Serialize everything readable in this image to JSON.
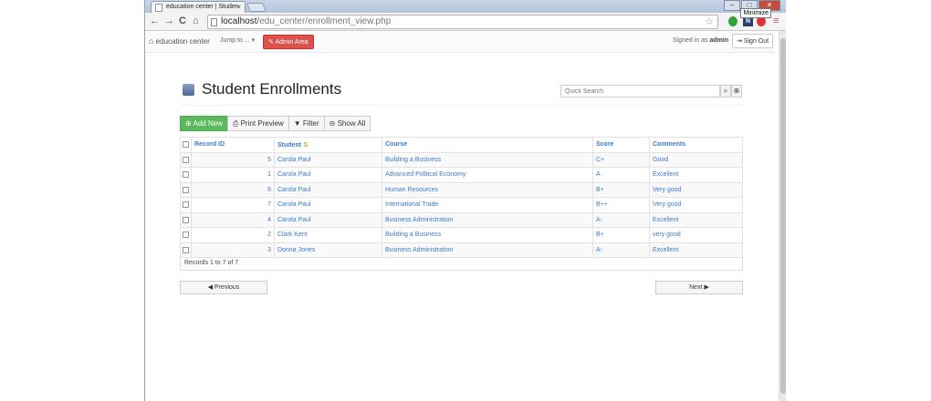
{
  "browser": {
    "tab_title": "education center | Studen",
    "tab_close": "×",
    "url_host": "localhost",
    "url_path": "/edu_center/enrollment_view.php",
    "tooltip": "Minimize",
    "back": "←",
    "forward": "→",
    "reload": "C",
    "home": "⌂",
    "star": "☆",
    "ext_badge": "N",
    "menu": "≡",
    "win_min": "–",
    "win_max": "□",
    "win_close": "✕"
  },
  "nav": {
    "brand": "education center",
    "jump": "Jump to ...",
    "admin": "Admin Area",
    "signed_prefix": "Signed in as",
    "user": "admin",
    "sign_out": "Sign Out"
  },
  "page": {
    "title": "Student Enrollments",
    "search_placeholder": "Quick Search",
    "search_btn": "⌕",
    "clear_btn": "⊗"
  },
  "toolbar": {
    "add_new": "Add New",
    "print_preview": "Print Preview",
    "filter": "Filter",
    "show_all": "Show All"
  },
  "table": {
    "headers": [
      "Record ID",
      "Student",
      "Course",
      "Score",
      "Comments"
    ],
    "sort_icon": "⇅",
    "rows": [
      {
        "id": "5",
        "student": "Carola Paul",
        "course": "Building a Business",
        "score": "C+",
        "comments": "Good"
      },
      {
        "id": "1",
        "student": "Carola Paul",
        "course": "Advanced Political Economy",
        "score": "A",
        "comments": "Excellent"
      },
      {
        "id": "6",
        "student": "Carola Paul",
        "course": "Human Resources",
        "score": "B+",
        "comments": "Very good"
      },
      {
        "id": "7",
        "student": "Carola Paul",
        "course": "International Trade",
        "score": "B++",
        "comments": "Very good"
      },
      {
        "id": "4",
        "student": "Carola Paul",
        "course": "Business Administration",
        "score": "A-",
        "comments": "Excellent"
      },
      {
        "id": "2",
        "student": "Clark Kent",
        "course": "Building a Business",
        "score": "B+",
        "comments": "very good"
      },
      {
        "id": "3",
        "student": "Donna Jones",
        "course": "Business Administration",
        "score": "A-",
        "comments": "Excellent"
      }
    ],
    "records_label": "Records 1 to 7 of 7"
  },
  "pager": {
    "previous": "Previous",
    "next": "Next"
  }
}
